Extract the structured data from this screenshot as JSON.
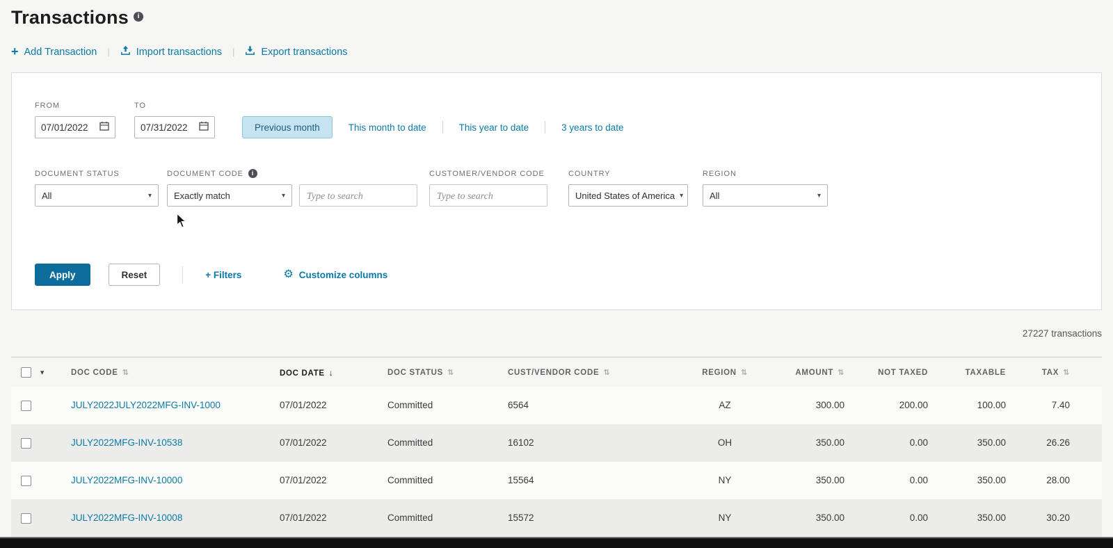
{
  "page": {
    "title": "Transactions",
    "count_label": "27227 transactions"
  },
  "toolbar": {
    "add_label": "Add Transaction",
    "import_label": "Import transactions",
    "export_label": "Export transactions"
  },
  "filters": {
    "from": {
      "label": "FROM",
      "value": "07/01/2022"
    },
    "to": {
      "label": "TO",
      "value": "07/31/2022"
    },
    "quick_ranges": {
      "previous_month": "Previous month",
      "month_to_date": "This month to date",
      "year_to_date": "This year to date",
      "three_years": "3 years to date"
    },
    "document_status": {
      "label": "DOCUMENT STATUS",
      "value": "All"
    },
    "document_code": {
      "label": "DOCUMENT CODE",
      "match": "Exactly match",
      "placeholder": "Type to search"
    },
    "customer_vendor": {
      "label": "CUSTOMER/VENDOR CODE",
      "placeholder": "Type to search"
    },
    "country": {
      "label": "COUNTRY",
      "value": "United States of America"
    },
    "region": {
      "label": "REGION",
      "value": "All"
    },
    "apply_label": "Apply",
    "reset_label": "Reset",
    "more_filters_label": "+ Filters",
    "customize_label": "Customize columns"
  },
  "icons": {
    "info": "i",
    "plus": "+",
    "chevron_down": "▾",
    "gear": "⚙",
    "sort": "⇅",
    "sorted": "↓",
    "header_chevron": "▾"
  },
  "colors": {
    "accent": "#0b7aa6",
    "apply_button": "#0d6c9b",
    "chip_background": "#c6e3f2"
  },
  "table": {
    "columns": [
      {
        "key": "doc_code",
        "label": "DOC CODE",
        "sortable": true,
        "align": "left"
      },
      {
        "key": "doc_date",
        "label": "DOC DATE",
        "sortable": true,
        "sorted": "desc",
        "align": "left"
      },
      {
        "key": "doc_status",
        "label": "DOC STATUS",
        "sortable": true,
        "align": "left"
      },
      {
        "key": "cust_vendor_code",
        "label": "CUST/VENDOR CODE",
        "sortable": true,
        "align": "left"
      },
      {
        "key": "region",
        "label": "REGION",
        "sortable": true,
        "align": "center"
      },
      {
        "key": "amount",
        "label": "AMOUNT",
        "sortable": true,
        "align": "right"
      },
      {
        "key": "not_taxed",
        "label": "NOT TAXED",
        "sortable": false,
        "align": "right"
      },
      {
        "key": "taxable",
        "label": "TAXABLE",
        "sortable": false,
        "align": "right"
      },
      {
        "key": "tax",
        "label": "TAX",
        "sortable": true,
        "align": "right"
      }
    ],
    "rows": [
      {
        "doc_code": "JULY2022JULY2022MFG-INV-1000",
        "doc_date": "07/01/2022",
        "doc_status": "Committed",
        "cust_vendor_code": "6564",
        "region": "AZ",
        "amount": "300.00",
        "not_taxed": "200.00",
        "taxable": "100.00",
        "tax": "7.40"
      },
      {
        "doc_code": "JULY2022MFG-INV-10538",
        "doc_date": "07/01/2022",
        "doc_status": "Committed",
        "cust_vendor_code": "16102",
        "region": "OH",
        "amount": "350.00",
        "not_taxed": "0.00",
        "taxable": "350.00",
        "tax": "26.26"
      },
      {
        "doc_code": "JULY2022MFG-INV-10000",
        "doc_date": "07/01/2022",
        "doc_status": "Committed",
        "cust_vendor_code": "15564",
        "region": "NY",
        "amount": "350.00",
        "not_taxed": "0.00",
        "taxable": "350.00",
        "tax": "28.00"
      },
      {
        "doc_code": "JULY2022MFG-INV-10008",
        "doc_date": "07/01/2022",
        "doc_status": "Committed",
        "cust_vendor_code": "15572",
        "region": "NY",
        "amount": "350.00",
        "not_taxed": "0.00",
        "taxable": "350.00",
        "tax": "30.20"
      }
    ]
  }
}
